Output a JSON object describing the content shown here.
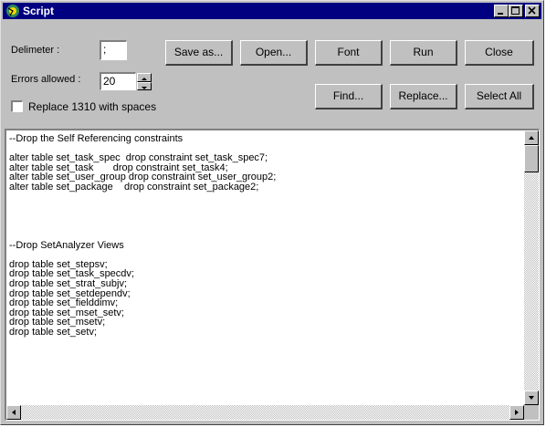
{
  "window": {
    "title": "Script"
  },
  "controls": {
    "delimiter_label": "Delimeter :",
    "delimiter_value": ";",
    "errors_label": "Errors allowed :",
    "errors_value": "20",
    "replace_checkbox_label": "Replace 1310 with spaces",
    "replace_checked": false
  },
  "buttons": {
    "save_as": "Save as...",
    "open": "Open...",
    "font": "Font",
    "run": "Run",
    "close": "Close",
    "find": "Find...",
    "replace": "Replace...",
    "select_all": "Select All"
  },
  "editor": {
    "lines": [
      "--Drop the Self Referencing constraints",
      "",
      "alter table set_task_spec  drop constraint set_task_spec7;",
      "alter table set_task       drop constraint set_task4;",
      "alter table set_user_group drop constraint set_user_group2;",
      "alter table set_package    drop constraint set_package2;",
      "",
      "",
      "",
      "",
      "",
      "--Drop SetAnalyzer Views",
      "",
      "drop table set_stepsv;",
      "drop table set_task_specdv;",
      "drop table set_strat_subjv;",
      "drop table set_setdependv;",
      "drop table set_fielddimv;",
      "drop table set_mset_setv;",
      "drop table set_msetv;",
      "drop table set_setv;"
    ]
  },
  "icons": {
    "app": "script-app-icon",
    "minimize": "minimize-icon",
    "maximize": "maximize-icon",
    "close": "close-icon",
    "spin_up": "arrow-up-icon",
    "spin_down": "arrow-down-icon",
    "scroll_up": "arrow-up-icon",
    "scroll_down": "arrow-down-icon",
    "scroll_left": "arrow-left-icon",
    "scroll_right": "arrow-right-icon"
  },
  "colors": {
    "titlebar": "#000080",
    "face": "#c0c0c0"
  }
}
